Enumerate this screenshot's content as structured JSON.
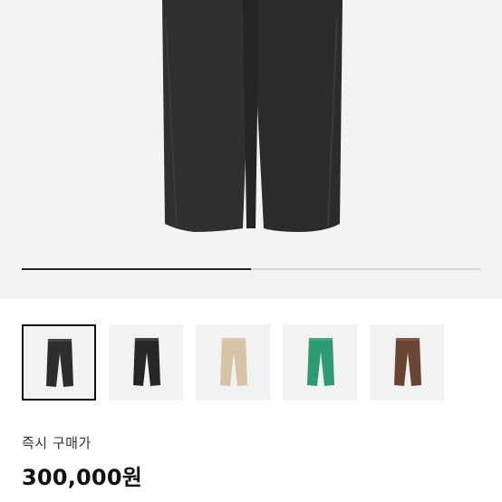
{
  "gallery": {
    "progress": 0.5,
    "thumbnails": [
      {
        "color": "#2d2d2d",
        "selected": true
      },
      {
        "color": "#262626",
        "selected": false
      },
      {
        "color": "#d7c3a6",
        "selected": false
      },
      {
        "color": "#2e9a72",
        "selected": false
      },
      {
        "color": "#6a4434",
        "selected": false
      }
    ]
  },
  "purchase": {
    "label": "즉시 구매가",
    "price": "300,000원"
  }
}
